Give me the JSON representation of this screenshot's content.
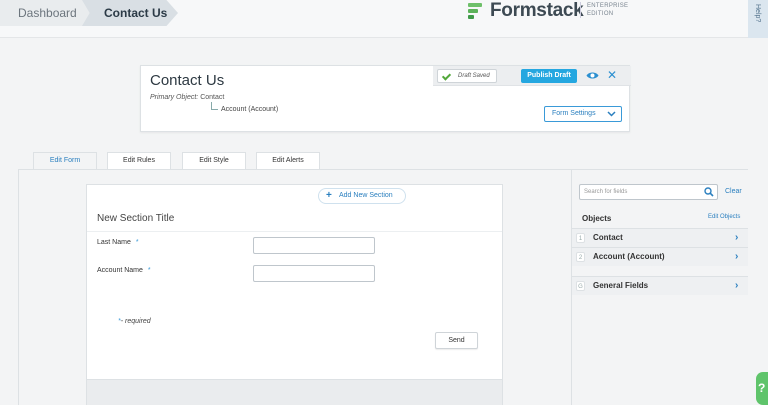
{
  "breadcrumb": {
    "dashboard": "Dashboard",
    "current": "Contact Us"
  },
  "brand": {
    "name": "Formstack",
    "edition_line1": "ENTERPRISE",
    "edition_line2": "EDITION"
  },
  "help_tab": "Help?",
  "header": {
    "title": "Contact Us",
    "primary_object_label": "Primary Object:",
    "primary_object": "Contact",
    "child_object": "Account (Account)",
    "draft_status": "Draft Saved",
    "publish_label": "Publish Draft",
    "form_settings_label": "Form Settings"
  },
  "tabs": [
    {
      "label": "Edit Form",
      "active": true
    },
    {
      "label": "Edit Rules"
    },
    {
      "label": "Edit Style"
    },
    {
      "label": "Edit Alerts"
    }
  ],
  "section": {
    "title": "New Section Title",
    "fields": [
      {
        "label": "Last Name",
        "required_mark": "*",
        "value": ""
      },
      {
        "label": "Account Name",
        "required_mark": "*",
        "value": ""
      }
    ],
    "required_mark": "*",
    "required_text": "- required",
    "send_label": "Send",
    "add_section_label": "Add New Section"
  },
  "sidebar": {
    "search_placeholder": "Search for fields",
    "clear_label": "Clear",
    "objects_heading": "Objects",
    "edit_objects_label": "Edit Objects",
    "objects": [
      {
        "num": "1",
        "name": "Contact"
      },
      {
        "num": "2",
        "name": "Account (Account)"
      }
    ],
    "general": {
      "num": "G",
      "name": "General Fields"
    }
  },
  "colors": {
    "accent": "#25a7e0",
    "link": "#2a7fbf",
    "success": "#53a83b",
    "help": "#5fc46b"
  }
}
